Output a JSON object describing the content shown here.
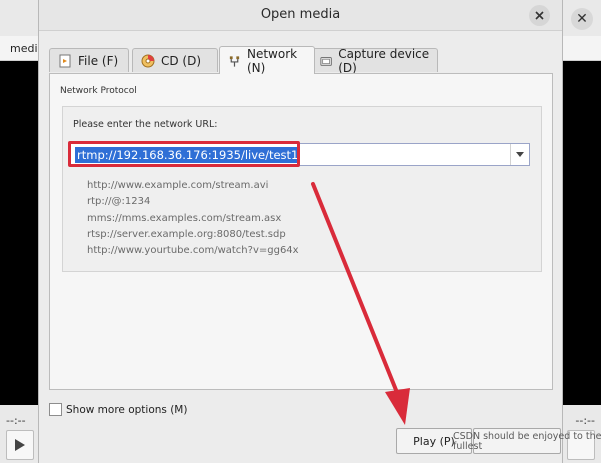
{
  "background": {
    "menu_label": "media",
    "time_left": "--:--",
    "time_right": "--:--"
  },
  "dialog": {
    "title": "Open media",
    "tabs": [
      {
        "label": "File (F)"
      },
      {
        "label": "CD (D)"
      },
      {
        "label": "Network (N)"
      },
      {
        "label": "Capture device (D)"
      }
    ],
    "group_label": "Network Protocol",
    "url_label": "Please enter the network URL:",
    "url_value": "rtmp://192.168.36.176:1935/live/test1",
    "examples": [
      "http://www.example.com/stream.avi",
      "rtp://@:1234",
      "mms://mms.examples.com/stream.asx",
      "rtsp://server.example.org:8080/test.sdp",
      "http://www.yourtube.com/watch?v=gg64x"
    ],
    "more_options_label": "Show more options (M)",
    "play_label": "Play (P)",
    "watermark": "CSDN should be enjoyed to the fullest"
  },
  "colors": {
    "accent": "#2f6fd6",
    "annotation": "#d92b3a"
  }
}
